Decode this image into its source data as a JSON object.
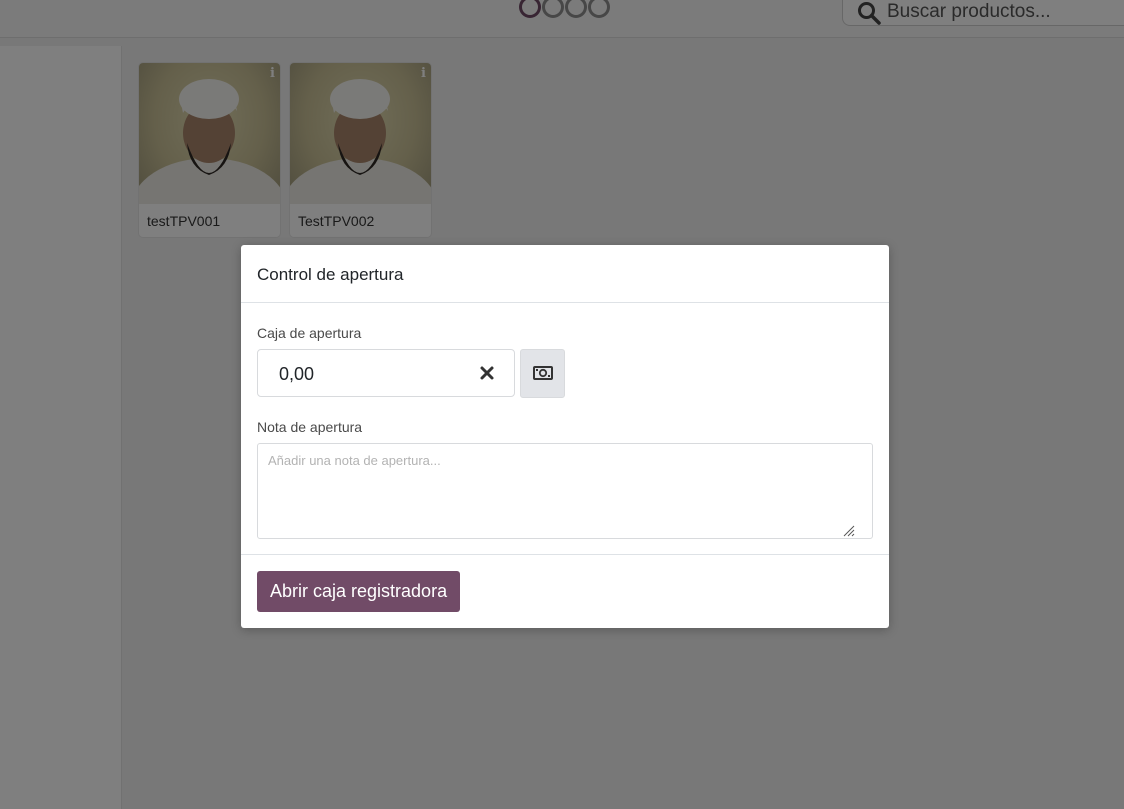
{
  "header": {
    "logo_name": "odoo-logo",
    "search": {
      "placeholder": "Buscar productos..."
    }
  },
  "products": [
    {
      "name": "testTPV001"
    },
    {
      "name": "TestTPV002"
    }
  ],
  "dialog": {
    "title": "Control de apertura",
    "cash_label": "Caja de apertura",
    "cash_value": "0,00",
    "note_label": "Nota de apertura",
    "note_placeholder": "Añadir una nota de apertura...",
    "open_button_label": "Abrir caja registradora"
  },
  "colors": {
    "primary": "#714b67",
    "backdrop": "rgba(0,0,0,0.5)"
  }
}
